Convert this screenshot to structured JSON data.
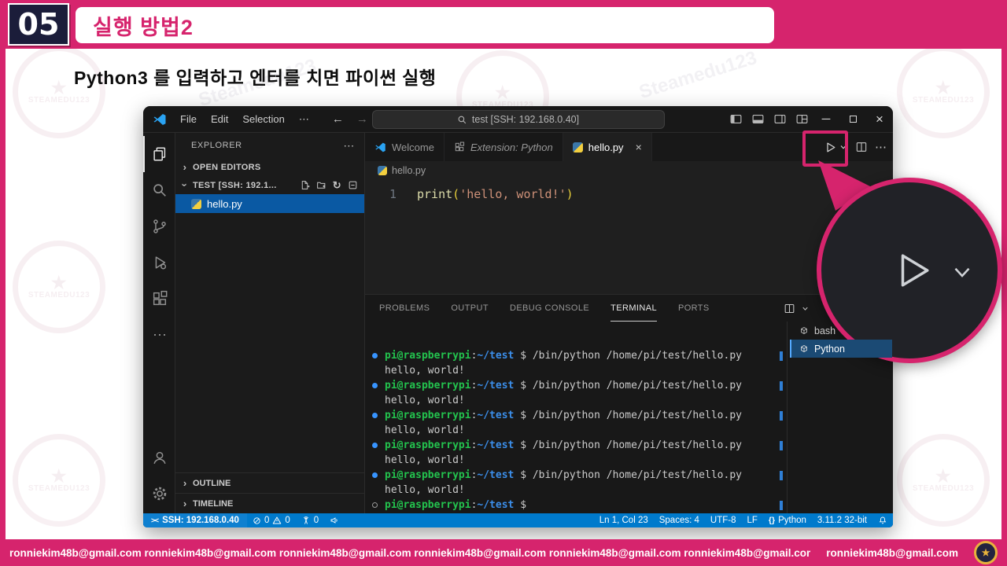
{
  "slide": {
    "number": "05",
    "title": "실행 방법2",
    "subtitle": "Python3 를 입력하고 엔터를 치면 파이썬 실행",
    "accent": "#d6246d",
    "footer_email": "ronniekim48b@gmail.com",
    "watermark_ring_text": "STEAMEDU123",
    "watermark_diag_text": "Steamedu123"
  },
  "icons": {
    "ellipsis": "⋯",
    "back": "←",
    "forward": "→",
    "minimize": "─",
    "close": "×",
    "chevron": "›",
    "refresh": "↻",
    "remote": "><",
    "braces": "{}",
    "star": "★"
  },
  "vscode": {
    "titlebar": {
      "menus": [
        "File",
        "Edit",
        "Selection"
      ],
      "search": "test [SSH: 192.168.0.40]"
    },
    "explorer": {
      "title": "EXPLORER",
      "open_editors": "OPEN EDITORS",
      "folder": "TEST [SSH: 192.1...",
      "file": "hello.py",
      "outline": "OUTLINE",
      "timeline": "TIMELINE"
    },
    "tabs": [
      {
        "label": "Welcome"
      },
      {
        "label": "Extension: Python"
      },
      {
        "label": "hello.py"
      }
    ],
    "breadcrumb": "hello.py",
    "editor": {
      "line_number": "1",
      "tok_fn": "print",
      "tok_open": "(",
      "tok_str": "'hello, world!'",
      "tok_close": ")"
    },
    "panel": {
      "tabs": [
        "PROBLEMS",
        "OUTPUT",
        "DEBUG CONSOLE",
        "TERMINAL",
        "PORTS"
      ],
      "active": "TERMINAL"
    },
    "terminal": {
      "repeats": 5,
      "user": "pi@raspberrypi",
      "separator": ":",
      "path": "~/test",
      "prompt_symbol": "$",
      "command": "/bin/python /home/pi/test/hello.py",
      "output": "hello, world!"
    },
    "terminal_tabs": [
      {
        "label": "bash"
      },
      {
        "label": "Python"
      }
    ],
    "statusbar": {
      "remote": "SSH: 192.168.0.40",
      "errors": "0",
      "warnings": "0",
      "ports": "0",
      "ln_col": "Ln 1, Col 23",
      "spaces": "Spaces: 4",
      "encoding": "UTF-8",
      "eol": "LF",
      "language": "Python",
      "interpreter": "3.11.2 32-bit"
    }
  }
}
